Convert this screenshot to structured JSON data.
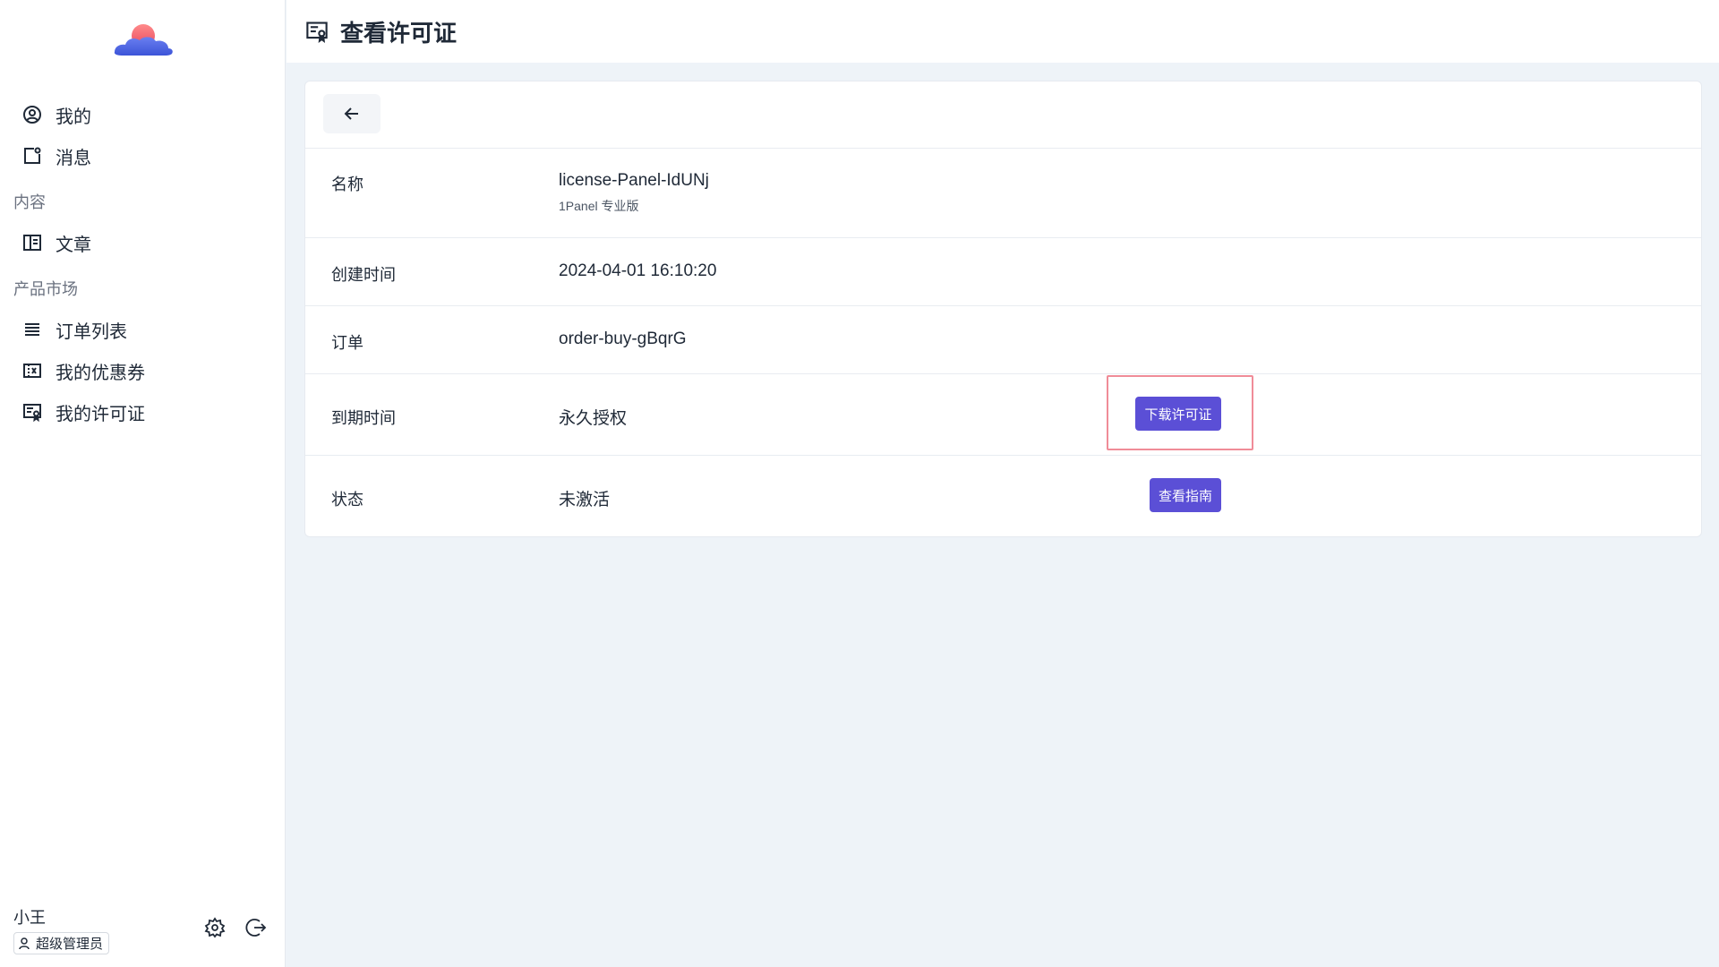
{
  "sidebar": {
    "items_top": [
      {
        "label": "我的",
        "icon": "user-circle-icon"
      },
      {
        "label": "消息",
        "icon": "message-icon"
      }
    ],
    "group_content": "内容",
    "items_content": [
      {
        "label": "文章",
        "icon": "article-icon"
      }
    ],
    "group_market": "产品市场",
    "items_market": [
      {
        "label": "订单列表",
        "icon": "list-icon"
      },
      {
        "label": "我的优惠券",
        "icon": "coupon-icon"
      },
      {
        "label": "我的许可证",
        "icon": "license-icon"
      }
    ],
    "user": {
      "name": "小王",
      "role": "超级管理员"
    }
  },
  "header": {
    "title": "查看许可证",
    "icon": "license-icon"
  },
  "license": {
    "name_label": "名称",
    "name_value": "license-Panel-IdUNj",
    "name_sub": "1Panel 专业版",
    "created_label": "创建时间",
    "created_value": "2024-04-01 16:10:20",
    "order_label": "订单",
    "order_value": "order-buy-gBqrG",
    "expire_label": "到期时间",
    "expire_value": "永久授权",
    "download_button": "下载许可证",
    "status_label": "状态",
    "status_value": "未激活",
    "guide_button": "查看指南"
  },
  "colors": {
    "primary": "#5b4fd6",
    "highlight": "#f08c98",
    "background": "#eef3f8"
  }
}
